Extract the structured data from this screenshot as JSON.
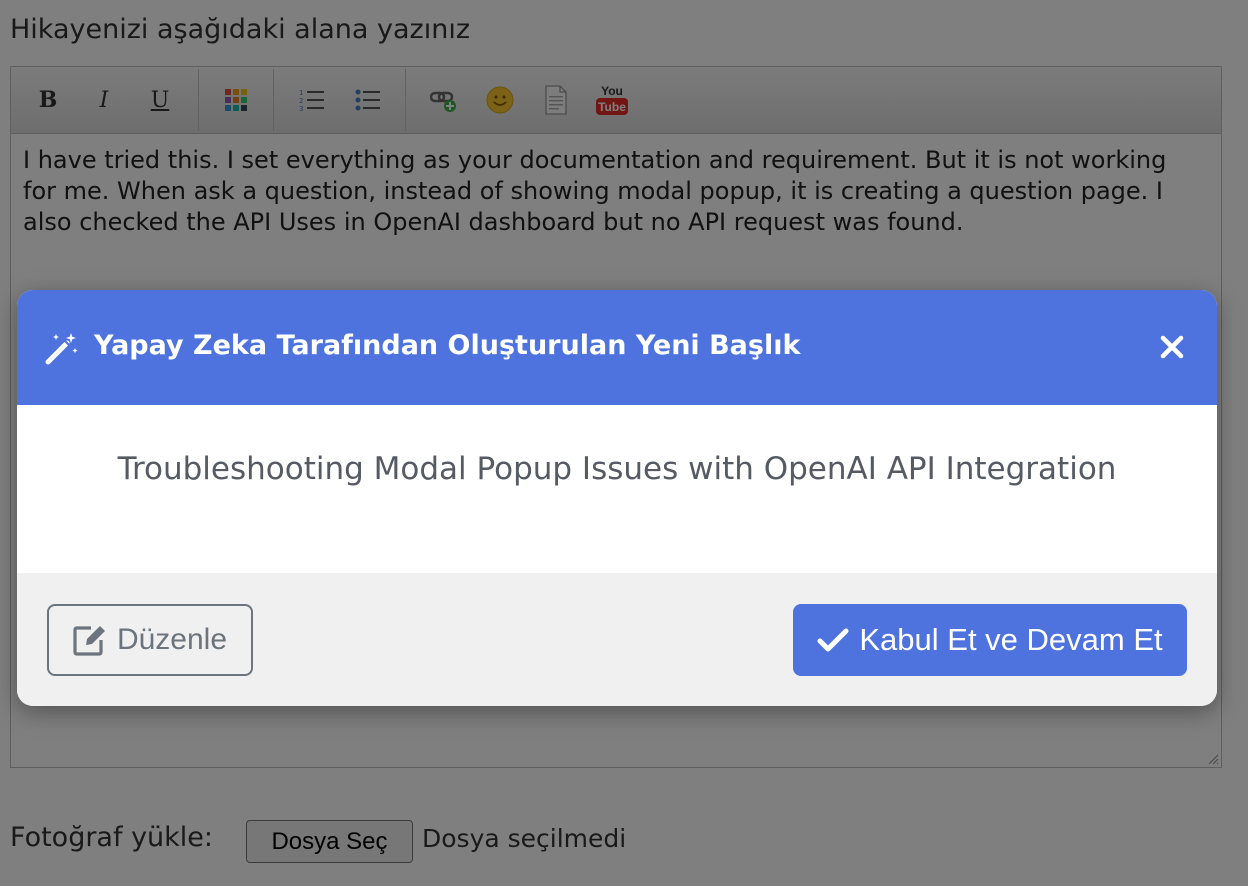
{
  "form": {
    "story_label": "Hikayenizi aşağıdaki alana yazınız",
    "editor_text": "I have tried this. I set everything as your documentation and requirement. But it is not working for me. When ask a question, instead of showing modal popup, it is creating a question page. I also checked the API Uses in OpenAI dashboard but no API request was found.",
    "toolbar": {
      "bold": "B",
      "italic": "I",
      "underline": "U",
      "youtube_top": "You",
      "youtube_bottom": "Tube",
      "icons": [
        "bold-icon",
        "italic-icon",
        "underline-icon",
        "color-palette-icon",
        "ordered-list-icon",
        "unordered-list-icon",
        "link-icon",
        "smiley-icon",
        "document-icon",
        "youtube-icon"
      ]
    },
    "upload_label": "Fotoğraf yükle:",
    "file_button": "Dosya Seç",
    "file_status": "Dosya seçilmedi"
  },
  "modal": {
    "title": "Yapay Zeka Tarafından Oluşturulan Yeni Başlık",
    "generated_title": "Troubleshooting Modal Popup Issues with OpenAI API Integration",
    "edit_button": "Düzenle",
    "accept_button": "Kabul Et ve Devam Et",
    "header_icon": "magic-wand-icon",
    "close_icon": "close-icon",
    "accent_color": "#4e73df"
  }
}
